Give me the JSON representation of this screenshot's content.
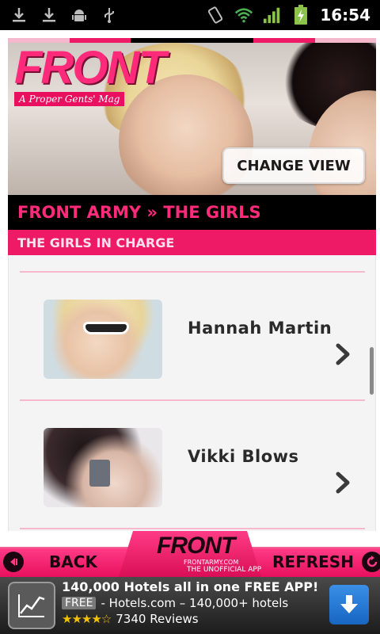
{
  "status_bar": {
    "time": "16:54",
    "icons_left": [
      "download-icon",
      "download-icon",
      "android-debug-icon",
      "usb-icon"
    ],
    "icons_right": [
      "vibrate-icon",
      "wifi-icon",
      "signal-icon",
      "battery-charging-icon"
    ]
  },
  "colors": {
    "accent_pink": "#ee1a66",
    "title_pink": "#ff2a7a",
    "header_black": "#000000"
  },
  "banner": {
    "logo_text": "FRONT",
    "logo_tagline": "A Proper Gents' Mag",
    "change_view_label": "CHANGE VIEW"
  },
  "page_title": "FRONT ARMY » THE GIRLS",
  "section_title": "THE GIRLS IN CHARGE",
  "items": [
    {
      "name": "Hannah Martin"
    },
    {
      "name": "Vikki Blows"
    }
  ],
  "bottom_nav": {
    "back_label": "BACK",
    "refresh_label": "REFRESH",
    "logo_text": "FRONT",
    "logo_sub": "FRONTARMY.COM",
    "tagline": "THE UNOFFICIAL APP"
  },
  "ad": {
    "title": "140,000 Hotels all in one FREE APP!",
    "free_badge": "FREE",
    "line2": "- Hotels.com – 140,000+ hotels",
    "stars": "★★★★☆",
    "reviews": "7340 Reviews"
  }
}
